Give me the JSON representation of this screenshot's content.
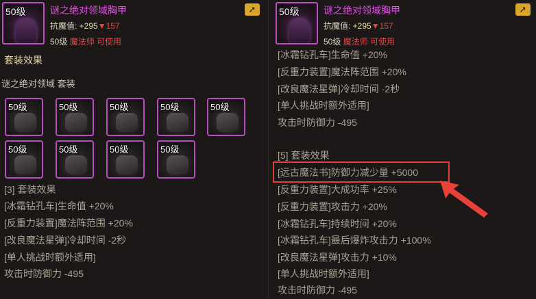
{
  "item": {
    "level": "50级",
    "name": "谜之绝对领域胸甲",
    "resist_label": "抗魔值: ",
    "resist_up": "+295",
    "resist_down": "▼157",
    "req_level": "50级",
    "req_class": "魔法师 可使用"
  },
  "share_icon": "share-icon",
  "left_panel": {
    "set_title": "套装效果",
    "set_name": "谜之绝对领域  套装",
    "slots": [
      "50级",
      "50级",
      "50级",
      "50级",
      "50级",
      "50级",
      "50级",
      "50级",
      "50级"
    ],
    "lines": [
      "[3] 套装效果",
      "[冰霜钻孔车]生命值 +20%",
      "[反重力装置]魔法阵范围 +20%",
      "[改良魔法星弹]冷却时间 -2秒",
      "[单人挑战时额外适用]",
      "攻击时防御力 -495"
    ]
  },
  "right_panel": {
    "lines": [
      "[冰霜钻孔车]生命值 +20%",
      "[反重力装置]魔法阵范围 +20%",
      "[改良魔法星弹]冷却时间 -2秒",
      "[单人挑战时额外适用]",
      "攻击时防御力 -495",
      "[5] 套装效果",
      "[远古魔法书]防御力减少量 +5000",
      "[反重力装置]大成功率 +25%",
      "[反重力装置]攻击力 +20%",
      "[冰霜钻孔车]持续时间 +20%",
      "[冰霜钻孔车]最后爆炸攻击力 +100%",
      "[改良魔法星弹]攻击力 +10%",
      "[单人挑战时额外适用]",
      "攻击时防御力 -495"
    ]
  },
  "colors": {
    "item_name": "#e24fe6",
    "highlight": "#e0403a",
    "resist_down": "#e04848"
  }
}
